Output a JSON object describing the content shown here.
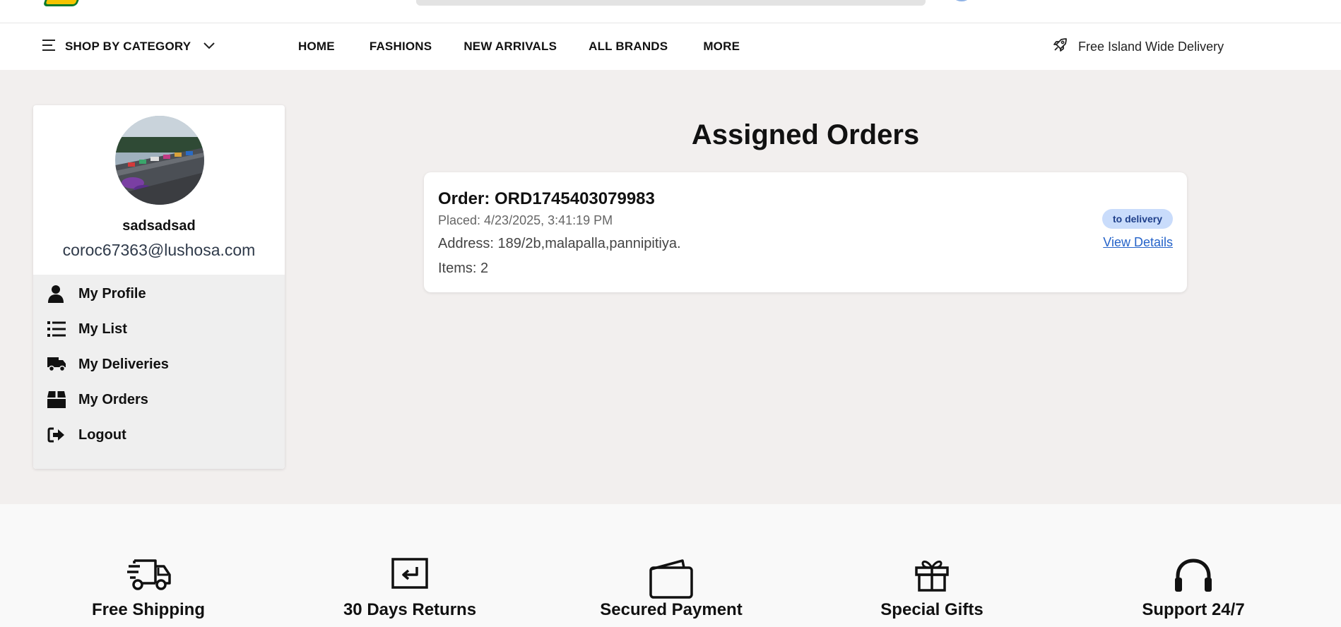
{
  "header": {
    "logo_icon": "store-logo-icon",
    "search_icon": "search-bar",
    "account_icon": "account-icon"
  },
  "navbar": {
    "shop_by_category": "SHOP BY CATEGORY",
    "links": [
      "HOME",
      "FASHIONS",
      "NEW ARRIVALS",
      "ALL BRANDS",
      "MORE"
    ],
    "delivery_note": "Free Island Wide Delivery"
  },
  "profile": {
    "username": "sadsadsad",
    "email": "coroc67363@lushosa.com",
    "avatar_icon": "avatar-photo"
  },
  "menu": {
    "items": [
      {
        "label": "My Profile",
        "icon": "user-icon"
      },
      {
        "label": "My List",
        "icon": "list-icon"
      },
      {
        "label": "My Deliveries",
        "icon": "truck-icon"
      },
      {
        "label": "My Orders",
        "icon": "box-icon"
      },
      {
        "label": "Logout",
        "icon": "logout-icon"
      }
    ]
  },
  "main": {
    "title": "Assigned Orders",
    "orders": [
      {
        "id_text": "Order: ORD1745403079983",
        "placed_text": "Placed: 4/23/2025, 3:41:19 PM",
        "address_text": "Address: 189/2b,malapalla,pannipitiya.",
        "items_text": "Items: 2",
        "status": "to delivery",
        "action": "View Details"
      }
    ]
  },
  "features": [
    {
      "label": "Free Shipping",
      "icon": "shipping-truck-icon"
    },
    {
      "label": "30 Days Returns",
      "icon": "return-icon"
    },
    {
      "label": "Secured Payment",
      "icon": "wallet-icon"
    },
    {
      "label": "Special Gifts",
      "icon": "gift-icon"
    },
    {
      "label": "Support 24/7",
      "icon": "headset-icon"
    }
  ],
  "colors": {
    "page_bg": "#f2efee",
    "badge_bg": "#c9dcfb",
    "badge_text": "#1e3f8a",
    "link": "#2563c9"
  }
}
